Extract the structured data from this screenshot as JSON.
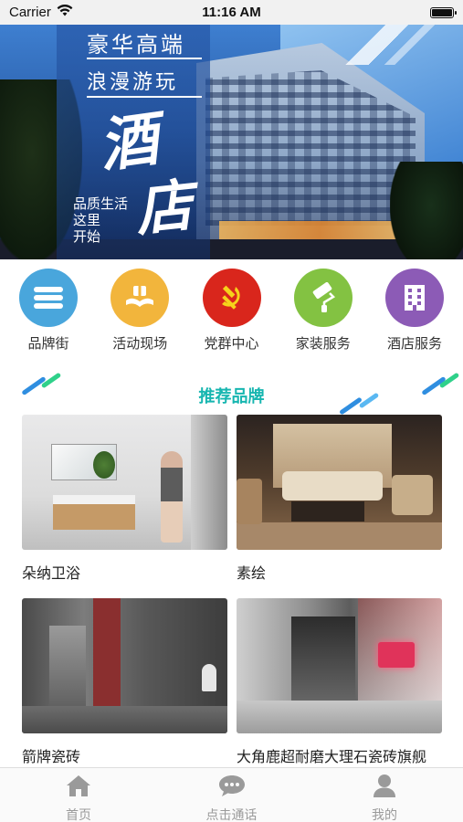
{
  "status_bar": {
    "carrier": "Carrier",
    "time": "11:16 AM",
    "battery_level": 1.0
  },
  "banner": {
    "line1": "豪华高端",
    "line2": "浪漫游玩",
    "big1": "酒",
    "big2": "店",
    "sub": [
      "品质生活",
      "这里",
      "开始"
    ],
    "dots_count": 0
  },
  "categories": [
    {
      "label": "品牌街",
      "icon": "menu-lines-icon",
      "color": "#49a6dc"
    },
    {
      "label": "活动现场",
      "icon": "handshake-gift-icon",
      "color": "#f2b53c"
    },
    {
      "label": "党群中心",
      "icon": "hammer-sickle-icon",
      "color": "#d9261c"
    },
    {
      "label": "家装服务",
      "icon": "paint-roller-icon",
      "color": "#83c242"
    },
    {
      "label": "酒店服务",
      "icon": "hotel-building-icon",
      "color": "#8c5bb6"
    }
  ],
  "section": {
    "title": "推荐品牌",
    "accent": "#17b6b0"
  },
  "brands": [
    {
      "name": "朵纳卫浴"
    },
    {
      "name": "素绘"
    },
    {
      "name": "箭牌瓷砖"
    },
    {
      "name": "大角鹿超耐磨大理石瓷砖旗舰"
    }
  ],
  "tabbar": [
    {
      "label": "首页",
      "icon": "home-icon"
    },
    {
      "label": "点击通话",
      "icon": "chat-bubble-icon"
    },
    {
      "label": "我的",
      "icon": "user-icon"
    }
  ]
}
